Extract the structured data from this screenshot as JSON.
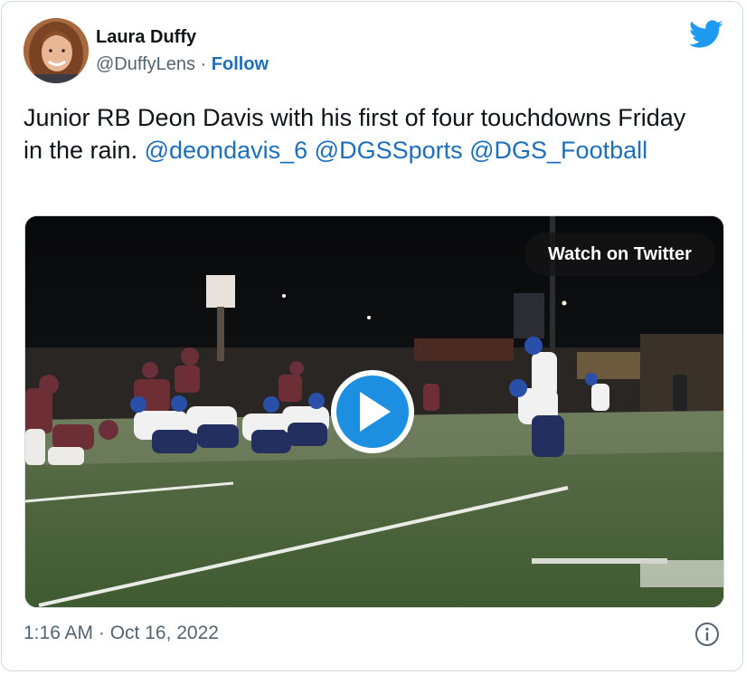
{
  "author": {
    "name": "Laura Duffy",
    "handle": "@DuffyLens",
    "separator": "·",
    "follow_label": "Follow"
  },
  "tweet": {
    "text_plain": "Junior RB Deon Davis with his first of four touchdowns Friday in the rain.",
    "mentions": [
      "@deondavis_6",
      "@DGSSports",
      "@DGS_Football"
    ]
  },
  "media": {
    "watch_label": "Watch on Twitter",
    "type": "video"
  },
  "footer": {
    "timestamp": "1:16 AM · Oct 16, 2022"
  },
  "icons": {
    "brand": "twitter-bird-icon",
    "play": "play-icon",
    "info": "info-icon"
  },
  "colors": {
    "twitter_blue": "#1d9bf0",
    "link_blue": "#1d6fb8",
    "text": "#0f1419",
    "muted": "#536471"
  }
}
